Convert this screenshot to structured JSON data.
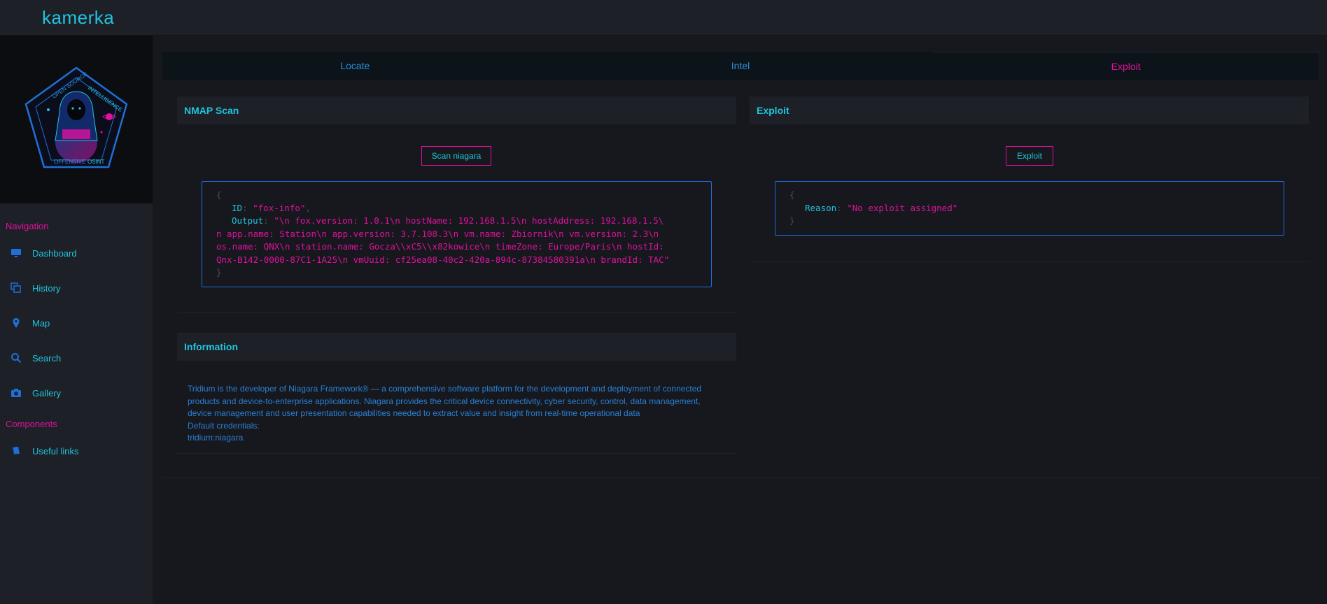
{
  "app": {
    "logo_text": "kamerka"
  },
  "badge": {
    "top_left_text": "OPEN SOURCE",
    "top_right_text": "INTELLIGENCE",
    "bottom_text_a": "OFFENSIVE",
    "bottom_text_b": "OSINT"
  },
  "sidebar": {
    "navigation_title": "Navigation",
    "nav_items": [
      {
        "label": "Dashboard",
        "icon": "monitor-icon"
      },
      {
        "label": "History",
        "icon": "copy-icon"
      },
      {
        "label": "Map",
        "icon": "map-pin-icon"
      },
      {
        "label": "Search",
        "icon": "search-icon"
      },
      {
        "label": "Gallery",
        "icon": "camera-icon"
      }
    ],
    "components_title": "Components",
    "component_items": [
      {
        "label": "Useful links",
        "icon": "book-icon"
      }
    ]
  },
  "tabs": [
    {
      "label": "Locate",
      "active": false
    },
    {
      "label": "Intel",
      "active": false
    },
    {
      "label": "Exploit",
      "active": true
    }
  ],
  "nmap": {
    "title": "NMAP Scan",
    "button_label": "Scan niagara",
    "result": {
      "open_brace": "{",
      "close_brace": "}",
      "id_key": "ID",
      "id_value": "\"fox-info\"",
      "output_key": "Output",
      "output_line1": "\"\\n  fox.version: 1.0.1\\n  hostName: 192.168.1.5\\n  hostAddress: 192.168.1.5\\",
      "output_line2": "n  app.name: Station\\n  app.version: 3.7.108.3\\n  vm.name: Zbiornik\\n  vm.version: 2.3\\n",
      "output_line3": "os.name: QNX\\n  station.name: Gocza\\\\xC5\\\\x82kowice\\n  timeZone: Europe/Paris\\n  hostId:",
      "output_line4": "Qnx-B142-0000-87C1-1A25\\n  vmUuid: cf25ea08-40c2-420a-894c-87384580391a\\n  brandId: TAC\""
    }
  },
  "exploit": {
    "title": "Exploit",
    "button_label": "Exploit",
    "result": {
      "open_brace": "{",
      "close_brace": "}",
      "reason_key": "Reason",
      "reason_value": "\"No exploit assigned\""
    }
  },
  "information": {
    "title": "Information",
    "paragraph_line1": "Tridium is the developer of Niagara Framework® — a comprehensive software platform for the development and deployment of connected",
    "paragraph_line2": "products and device-to-enterprise applications. Niagara provides the critical device connectivity, cyber security, control, data management,",
    "paragraph_line3": "device management and user presentation capabilities needed to extract value and insight from real-time operational data",
    "credentials_label": "Default credentials:",
    "credentials_value": "tridium:niagara"
  },
  "colors": {
    "accent_cyan": "#20c4de",
    "accent_magenta": "#e0109e",
    "link_blue": "#2a7fd4",
    "background": "#16181d"
  }
}
